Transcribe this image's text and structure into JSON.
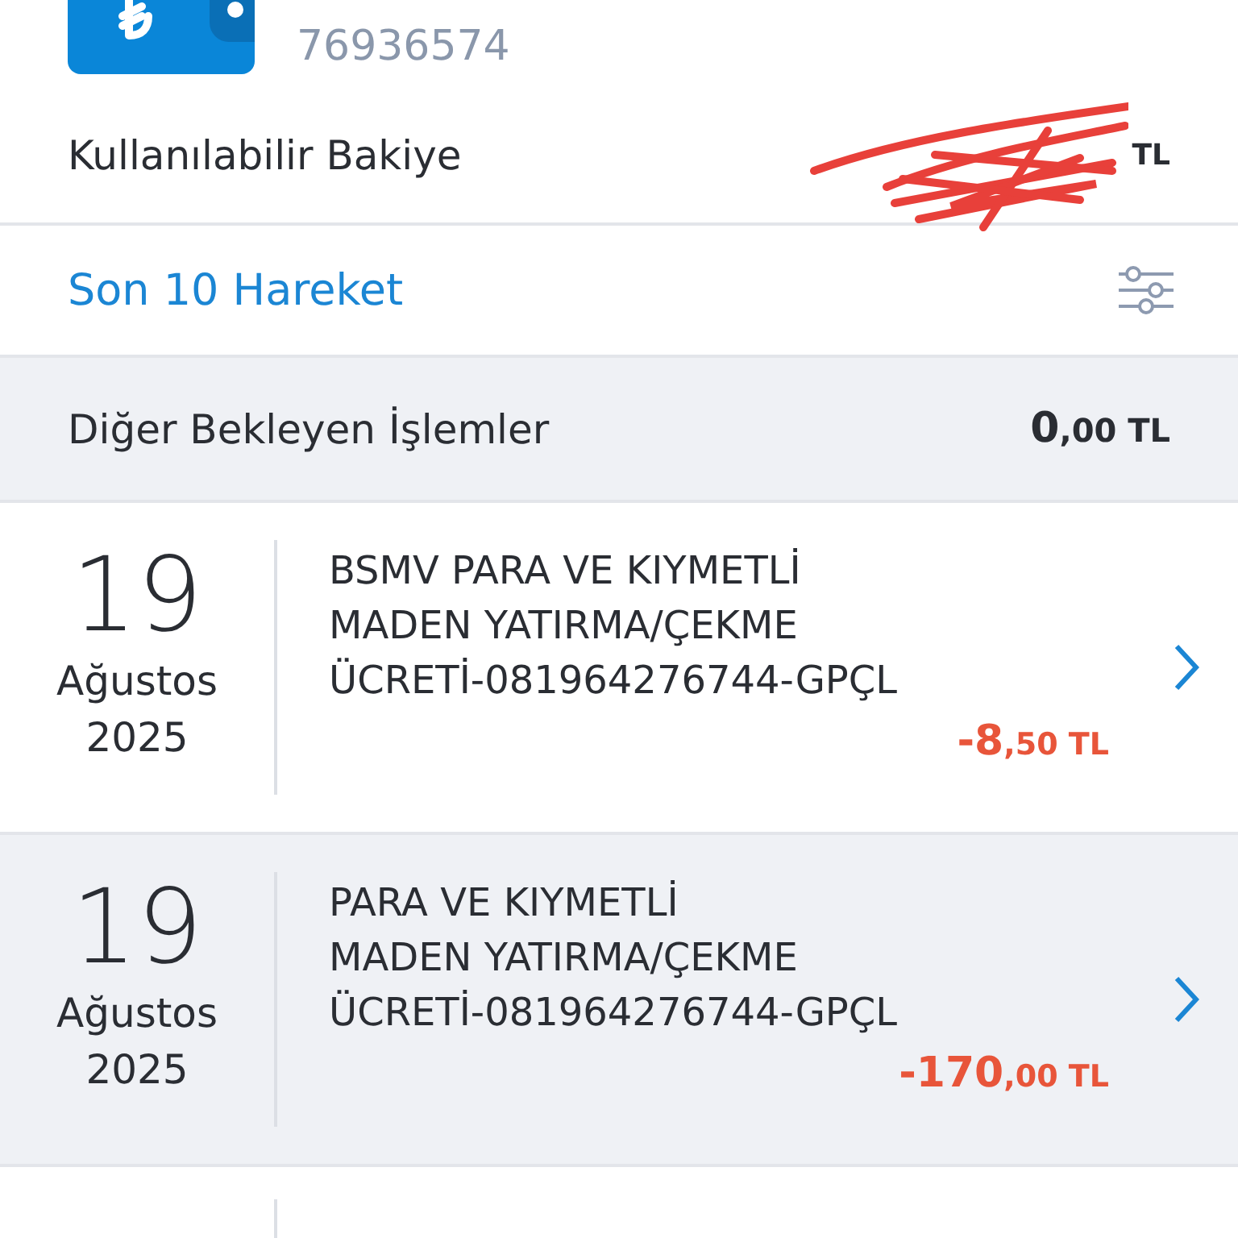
{
  "account": {
    "number": "76936574"
  },
  "balance": {
    "label": "Kullanılabilir Bakiye",
    "currency": "TL",
    "redacted": true
  },
  "section": {
    "title": "Son 10 Hareket"
  },
  "pending": {
    "label": "Diğer Bekleyen İşlemler",
    "amount": "0,00 TL"
  },
  "transactions": [
    {
      "day": "19",
      "month": "Ağustos",
      "year": "2025",
      "lines": [
        "BSMV PARA VE KIYMETLİ",
        "MADEN YATIRMA/ÇEKME",
        "ÜCRETİ-081964276744-GPÇL"
      ],
      "amount": "-8,50 TL",
      "shaded": false
    },
    {
      "day": "19",
      "month": "Ağustos",
      "year": "2025",
      "lines": [
        "PARA VE KIYMETLİ",
        "MADEN YATIRMA/ÇEKME",
        "ÜCRETİ-081964276744-GPÇL"
      ],
      "amount": "-170,00 TL",
      "shaded": true
    },
    {
      "shaded": false
    }
  ]
}
